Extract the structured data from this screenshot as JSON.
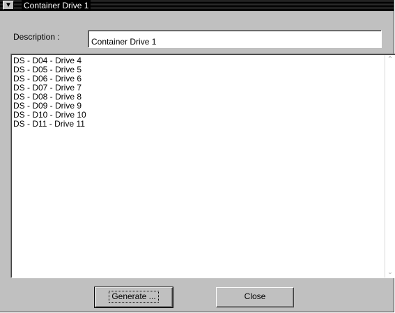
{
  "window": {
    "title": "Container Drive 1",
    "menu_icon": "system-menu-icon"
  },
  "description": {
    "label": "Description :",
    "value": "Container Drive 1"
  },
  "list": {
    "items": [
      "DS - D04 - Drive 4",
      "DS - D05 - Drive 5",
      "DS - D06 - Drive 6",
      "DS - D07 - Drive 7",
      "DS - D08 - Drive 8",
      "DS - D09 - Drive 9",
      "DS - D10 - Drive 10",
      "DS - D11 - Drive 11"
    ],
    "scroll_up_icon": "chevron-up-icon",
    "scroll_down_icon": "chevron-down-icon"
  },
  "buttons": {
    "generate": "Generate ...",
    "close": "Close"
  },
  "colors": {
    "face": "#c0c0c0",
    "titlebar": "#000000",
    "field": "#ffffff"
  }
}
